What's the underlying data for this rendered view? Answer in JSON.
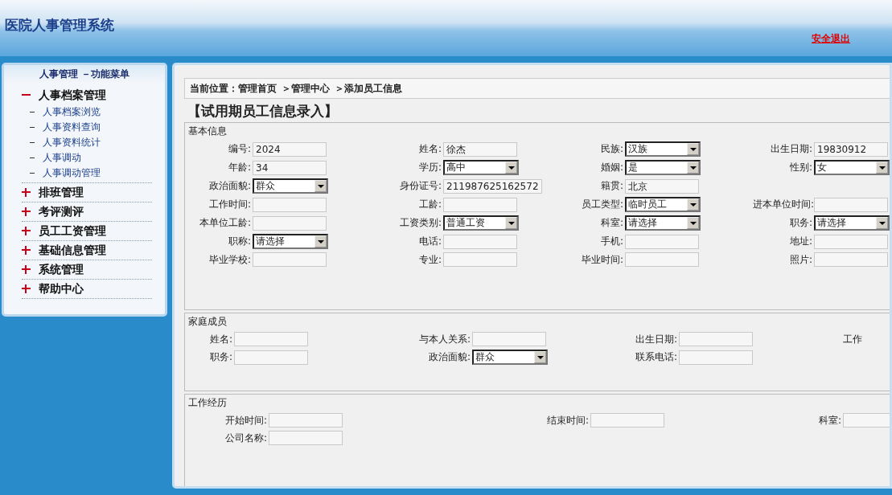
{
  "header": {
    "title": "医院人事管理系统",
    "logout_link": "安全退出"
  },
  "sidebar": {
    "title": "人事管理 －功能菜单",
    "groups": [
      {
        "label": "人事档案管理",
        "expanded": true,
        "children": [
          {
            "label": "人事档案浏览"
          },
          {
            "label": "人事资料查询"
          },
          {
            "label": "人事资料统计"
          },
          {
            "label": "人事调动"
          },
          {
            "label": "人事调动管理"
          }
        ]
      },
      {
        "label": "排班管理",
        "expanded": false
      },
      {
        "label": "考评测评",
        "expanded": false
      },
      {
        "label": "员工工资管理",
        "expanded": false
      },
      {
        "label": "基础信息管理",
        "expanded": false
      },
      {
        "label": "系统管理",
        "expanded": false
      },
      {
        "label": "帮助中心",
        "expanded": false
      }
    ]
  },
  "breadcrumb": [
    "当前位置：管理首页",
    "＞管理中心",
    "＞添加员工信息"
  ],
  "page_title": "【试用期员工信息录入】",
  "sections": [
    {
      "title": "基本信息",
      "rows": [
        [
          {
            "label": "编号:",
            "kind": "text",
            "value": "2024"
          },
          {
            "label": "姓名:",
            "kind": "text",
            "value": "徐杰"
          },
          {
            "label": "民族:",
            "kind": "select",
            "value": "汉族"
          },
          {
            "label": "出生日期:",
            "kind": "text",
            "value": "19830912"
          }
        ],
        [
          {
            "label": "年龄:",
            "kind": "text",
            "value": "34"
          },
          {
            "label": "学历:",
            "kind": "select",
            "value": "高中"
          },
          {
            "label": "婚姻:",
            "kind": "select",
            "value": "是"
          },
          {
            "label": "性别:",
            "kind": "select",
            "value": "女"
          }
        ],
        [
          {
            "label": "政治面貌:",
            "kind": "select",
            "value": "群众"
          },
          {
            "label": "身份证号:",
            "kind": "text",
            "value": "211987625162572"
          },
          {
            "label": "籍贯:",
            "kind": "text",
            "value": "北京"
          }
        ],
        [
          {
            "label": "工作时间:",
            "kind": "text"
          },
          {
            "label": "工龄:",
            "kind": "text"
          },
          {
            "label": "员工类型:",
            "kind": "select",
            "value": "临时员工"
          },
          {
            "label": "进本单位时间:",
            "kind": "text"
          }
        ],
        [
          {
            "label": "本单位工龄:",
            "kind": "text"
          },
          {
            "label": "工资类别:",
            "kind": "select",
            "value": "普通工资"
          },
          {
            "label": "科室:",
            "kind": "select",
            "value": "请选择"
          },
          {
            "label": "职务:",
            "kind": "select",
            "value": "请选择"
          }
        ],
        [
          {
            "label": "职称:",
            "kind": "select",
            "value": "请选择"
          },
          {
            "label": "电话:",
            "kind": "text"
          },
          {
            "label": "手机:",
            "kind": "text"
          },
          {
            "label": "地址:",
            "kind": "text"
          }
        ],
        [
          {
            "label": "毕业学校:",
            "kind": "text"
          },
          {
            "label": "专业:",
            "kind": "text"
          },
          {
            "label": "毕业时间:",
            "kind": "text"
          },
          {
            "label": "照片:",
            "kind": "text"
          }
        ]
      ]
    },
    {
      "title": "家庭成员",
      "rows": [
        [
          {
            "label": "姓名:",
            "kind": "text"
          },
          {
            "label": "与本人关系:",
            "kind": "text"
          },
          {
            "label": "出生日期:",
            "kind": "text"
          },
          {
            "label": "工作",
            "kind": "cut"
          }
        ],
        [
          {
            "label": "职务:",
            "kind": "text"
          },
          {
            "label": "政治面貌:",
            "kind": "select",
            "value": "群众"
          },
          {
            "label": "联系电话:",
            "kind": "text"
          }
        ]
      ]
    },
    {
      "title": "工作经历",
      "rows": [
        [
          {
            "label": "开始时间:",
            "kind": "text"
          },
          {
            "label": "结束时间:",
            "kind": "text"
          },
          {
            "label": "科室:",
            "kind": "text"
          }
        ],
        [
          {
            "label": "公司名称:",
            "kind": "text"
          }
        ]
      ]
    }
  ]
}
